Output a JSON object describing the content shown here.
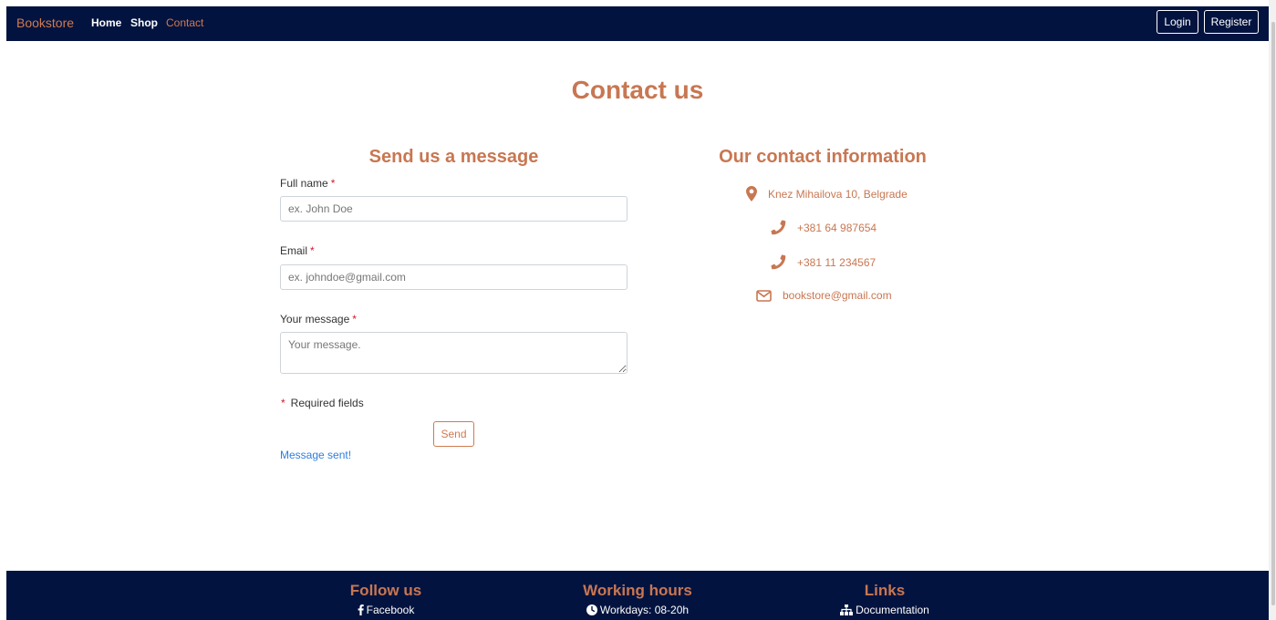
{
  "navbar": {
    "brand": "Bookstore",
    "links": [
      "Home",
      "Shop",
      "Contact"
    ],
    "login": "Login",
    "register": "Register"
  },
  "page_title": "Contact us",
  "form": {
    "title": "Send us a message",
    "full_name_label": "Full name",
    "full_name_placeholder": "ex. John Doe",
    "email_label": "Email",
    "email_placeholder": "ex. johndoe@gmail.com",
    "message_label": "Your message",
    "message_placeholder": "Your message.",
    "required_asterisk": "*",
    "required_note": "Required fields",
    "send": "Send",
    "status": "Message sent!"
  },
  "contact": {
    "title": "Our contact information",
    "address": "Knez Mihailova 10, Belgrade",
    "phone1": "+381 64 987654",
    "phone2": "+381 11 234567",
    "email": "bookstore@gmail.com"
  },
  "footer": {
    "follow_title": "Follow us",
    "facebook": "Facebook",
    "hours_title": "Working hours",
    "hours": "Workdays: 08-20h",
    "links_title": "Links",
    "documentation": "Documentation"
  },
  "colors": {
    "navy": "#03133f",
    "accent": "#c87752",
    "required": "#d9162b",
    "status": "#2b7fe0"
  }
}
